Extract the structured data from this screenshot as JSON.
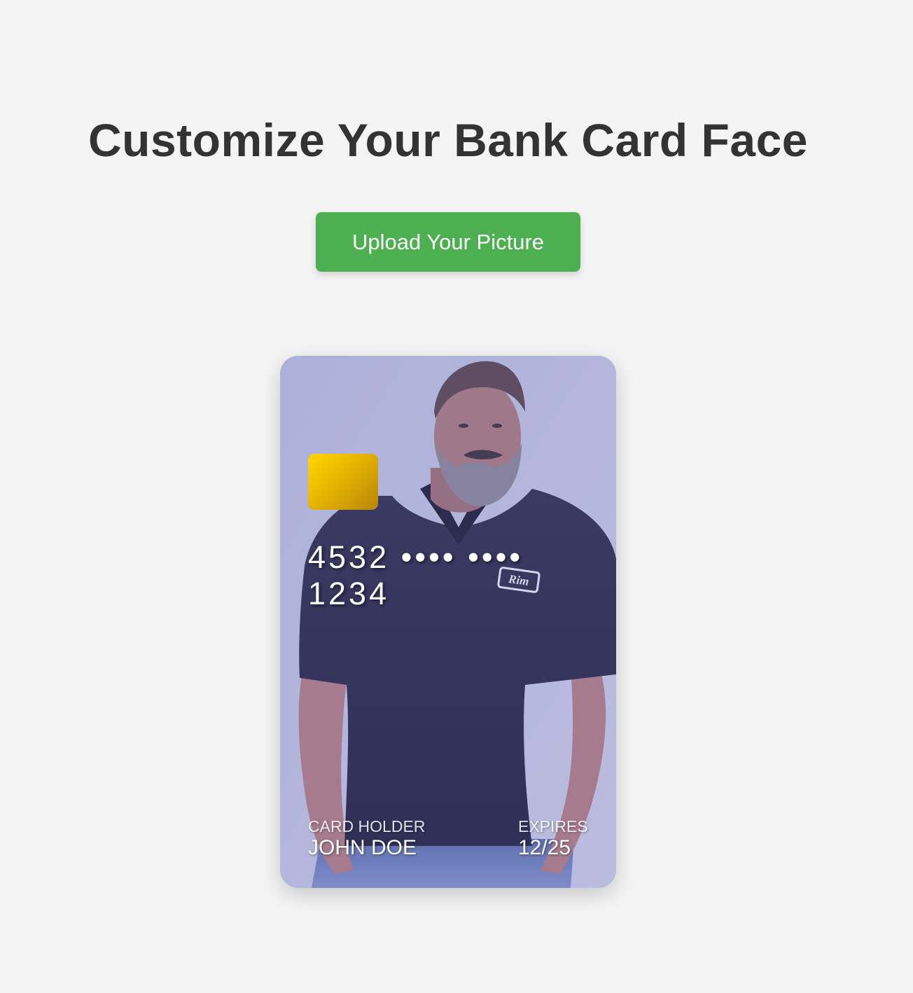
{
  "page": {
    "title": "Customize Your Bank Card Face"
  },
  "upload": {
    "button_label": "Upload Your Picture"
  },
  "card": {
    "number_line_1": "4532 •••• ••••",
    "number_line_2": "1234",
    "holder_label": "CARD HOLDER",
    "holder_name": "JOHN DOE",
    "expires_label": "EXPIRES",
    "expires_value": "12/25",
    "shirt_logo_text": "Rim"
  },
  "colors": {
    "background": "#f4f4f4",
    "title": "#333333",
    "button": "#4caf50",
    "chip_start": "#ffd700",
    "chip_end": "#b8860b"
  }
}
